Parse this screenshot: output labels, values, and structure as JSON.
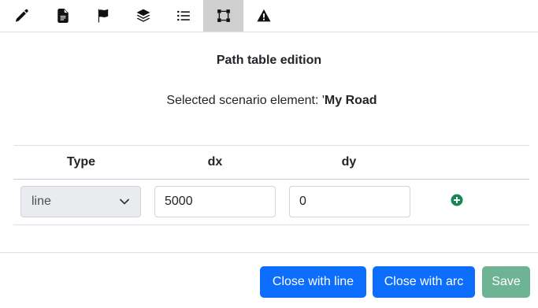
{
  "toolbar": {
    "tools": [
      {
        "icon": "pencil-icon"
      },
      {
        "icon": "document-icon"
      },
      {
        "icon": "flag-icon"
      },
      {
        "icon": "layers-icon"
      },
      {
        "icon": "list-icon"
      },
      {
        "icon": "path-vertices-icon",
        "active": true
      },
      {
        "icon": "warning-icon"
      }
    ]
  },
  "header": {
    "title": "Path table edition",
    "selected_label": "Selected scenario element: '",
    "selected_value": "My Road"
  },
  "table": {
    "columns": [
      "Type",
      "dx",
      "dy"
    ],
    "rows": [
      {
        "type": "line",
        "dx": "5000",
        "dy": "0"
      }
    ]
  },
  "footer": {
    "close_line_label": "Close with line",
    "close_arc_label": "Close with arc",
    "save_label": "Save"
  },
  "colors": {
    "primary": "#0d6efd",
    "save_disabled": "#6fb395",
    "add_icon": "#198754",
    "active_tool": "#cfcfcf"
  }
}
